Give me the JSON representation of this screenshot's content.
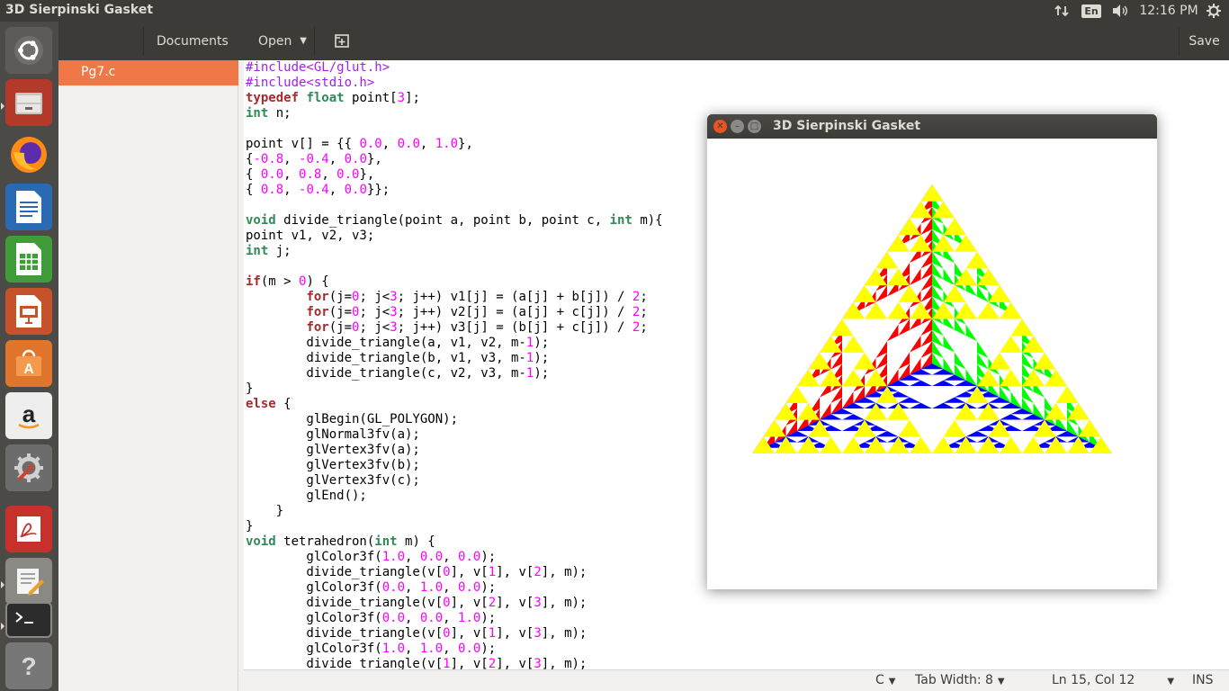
{
  "window_title": "3D Sierpinski Gasket",
  "top_panel": {
    "language": "En",
    "clock": "12:16 PM",
    "icons": [
      "network-icon",
      "volume-icon",
      "settings-gear-icon"
    ]
  },
  "launcher": {
    "items": [
      {
        "name": "ubuntu-dash",
        "active": false
      },
      {
        "name": "files",
        "active": true
      },
      {
        "name": "firefox",
        "active": false
      },
      {
        "name": "libreoffice-writer",
        "active": false
      },
      {
        "name": "libreoffice-calc",
        "active": false
      },
      {
        "name": "libreoffice-impress",
        "active": false
      },
      {
        "name": "ubuntu-software",
        "active": false
      },
      {
        "name": "amazon",
        "active": false
      },
      {
        "name": "system-settings",
        "active": false
      },
      {
        "name": "document-viewer",
        "active": false
      },
      {
        "name": "text-editor",
        "active": true
      },
      {
        "name": "terminal",
        "active": true
      },
      {
        "name": "help",
        "active": false
      }
    ]
  },
  "gedit": {
    "documents_label": "Documents",
    "open_label": "Open",
    "save_label": "Save",
    "files": [
      {
        "name": "Pg7.c",
        "selected": true
      }
    ],
    "status": {
      "language": "C",
      "tab_width": "Tab Width: 8",
      "position": "Ln 15, Col 12",
      "mode": "INS"
    },
    "code_lines": [
      [
        [
          "pp",
          "#include<GL/glut.h>"
        ]
      ],
      [
        [
          "pp",
          "#include<stdio.h>"
        ]
      ],
      [
        [
          "kw",
          "typedef"
        ],
        [
          "",
          " "
        ],
        [
          "ty",
          "float"
        ],
        [
          "",
          " point["
        ],
        [
          "num",
          "3"
        ],
        [
          "",
          "];"
        ]
      ],
      [
        [
          "ty",
          "int"
        ],
        [
          "",
          " n;"
        ]
      ],
      [],
      [
        [
          "",
          "point v[] = {{ "
        ],
        [
          "num",
          "0.0"
        ],
        [
          "",
          ", "
        ],
        [
          "num",
          "0.0"
        ],
        [
          "",
          ", "
        ],
        [
          "num",
          "1.0"
        ],
        [
          "",
          "},"
        ]
      ],
      [
        [
          "",
          "{"
        ],
        [
          "num",
          "-0.8"
        ],
        [
          "",
          ", "
        ],
        [
          "num",
          "-0.4"
        ],
        [
          "",
          ", "
        ],
        [
          "num",
          "0.0"
        ],
        [
          "",
          "},"
        ]
      ],
      [
        [
          "",
          "{ "
        ],
        [
          "num",
          "0.0"
        ],
        [
          "",
          ", "
        ],
        [
          "num",
          "0.8"
        ],
        [
          "",
          ", "
        ],
        [
          "num",
          "0.0"
        ],
        [
          "",
          "},"
        ]
      ],
      [
        [
          "",
          "{ "
        ],
        [
          "num",
          "0.8"
        ],
        [
          "",
          ", "
        ],
        [
          "num",
          "-0.4"
        ],
        [
          "",
          ", "
        ],
        [
          "num",
          "0.0"
        ],
        [
          "",
          "}};"
        ]
      ],
      [],
      [
        [
          "ty",
          "void"
        ],
        [
          "",
          " divide_triangle(point a, point b, point c, "
        ],
        [
          "ty",
          "int"
        ],
        [
          "",
          " m){"
        ]
      ],
      [
        [
          "",
          "point v1, v2, v3;"
        ]
      ],
      [
        [
          "ty",
          "int"
        ],
        [
          "",
          " j;"
        ]
      ],
      [],
      [
        [
          "kw",
          "if"
        ],
        [
          "",
          "(m > "
        ],
        [
          "num",
          "0"
        ],
        [
          "",
          ") {"
        ]
      ],
      [
        [
          "",
          "        "
        ],
        [
          "kw",
          "for"
        ],
        [
          "",
          "(j="
        ],
        [
          "num",
          "0"
        ],
        [
          "",
          "; j<"
        ],
        [
          "num",
          "3"
        ],
        [
          "",
          "; j++) v1[j] = (a[j] + b[j]) / "
        ],
        [
          "num",
          "2"
        ],
        [
          "",
          ";"
        ]
      ],
      [
        [
          "",
          "        "
        ],
        [
          "kw",
          "for"
        ],
        [
          "",
          "(j="
        ],
        [
          "num",
          "0"
        ],
        [
          "",
          "; j<"
        ],
        [
          "num",
          "3"
        ],
        [
          "",
          "; j++) v2[j] = (a[j] + c[j]) / "
        ],
        [
          "num",
          "2"
        ],
        [
          "",
          ";"
        ]
      ],
      [
        [
          "",
          "        "
        ],
        [
          "kw",
          "for"
        ],
        [
          "",
          "(j="
        ],
        [
          "num",
          "0"
        ],
        [
          "",
          "; j<"
        ],
        [
          "num",
          "3"
        ],
        [
          "",
          "; j++) v3[j] = (b[j] + c[j]) / "
        ],
        [
          "num",
          "2"
        ],
        [
          "",
          ";"
        ]
      ],
      [
        [
          "",
          "        divide_triangle(a, v1, v2, m-"
        ],
        [
          "num",
          "1"
        ],
        [
          "",
          ");"
        ]
      ],
      [
        [
          "",
          "        divide_triangle(b, v1, v3, m-"
        ],
        [
          "num",
          "1"
        ],
        [
          "",
          ");"
        ]
      ],
      [
        [
          "",
          "        divide_triangle(c, v2, v3, m-"
        ],
        [
          "num",
          "1"
        ],
        [
          "",
          ");"
        ]
      ],
      [
        [
          "",
          "}"
        ]
      ],
      [
        [
          "kw",
          "else"
        ],
        [
          "",
          " {"
        ]
      ],
      [
        [
          "",
          "        glBegin(GL_POLYGON);"
        ]
      ],
      [
        [
          "",
          "        glNormal3fv(a);"
        ]
      ],
      [
        [
          "",
          "        glVertex3fv(a);"
        ]
      ],
      [
        [
          "",
          "        glVertex3fv(b);"
        ]
      ],
      [
        [
          "",
          "        glVertex3fv(c);"
        ]
      ],
      [
        [
          "",
          "        glEnd();"
        ]
      ],
      [
        [
          "",
          "    }"
        ]
      ],
      [
        [
          "",
          "}"
        ]
      ],
      [
        [
          "ty",
          "void"
        ],
        [
          "",
          " tetrahedron("
        ],
        [
          "ty",
          "int"
        ],
        [
          "",
          " m) {"
        ]
      ],
      [
        [
          "",
          "        glColor3f("
        ],
        [
          "num",
          "1.0"
        ],
        [
          "",
          ", "
        ],
        [
          "num",
          "0.0"
        ],
        [
          "",
          ", "
        ],
        [
          "num",
          "0.0"
        ],
        [
          "",
          ");"
        ]
      ],
      [
        [
          "",
          "        divide_triangle(v["
        ],
        [
          "num",
          "0"
        ],
        [
          "",
          "], v["
        ],
        [
          "num",
          "1"
        ],
        [
          "",
          "], v["
        ],
        [
          "num",
          "2"
        ],
        [
          "",
          "], m);"
        ]
      ],
      [
        [
          "",
          "        glColor3f("
        ],
        [
          "num",
          "0.0"
        ],
        [
          "",
          ", "
        ],
        [
          "num",
          "1.0"
        ],
        [
          "",
          ", "
        ],
        [
          "num",
          "0.0"
        ],
        [
          "",
          ");"
        ]
      ],
      [
        [
          "",
          "        divide_triangle(v["
        ],
        [
          "num",
          "0"
        ],
        [
          "",
          "], v["
        ],
        [
          "num",
          "2"
        ],
        [
          "",
          "], v["
        ],
        [
          "num",
          "3"
        ],
        [
          "",
          "], m);"
        ]
      ],
      [
        [
          "",
          "        glColor3f("
        ],
        [
          "num",
          "0.0"
        ],
        [
          "",
          ", "
        ],
        [
          "num",
          "0.0"
        ],
        [
          "",
          ", "
        ],
        [
          "num",
          "1.0"
        ],
        [
          "",
          ");"
        ]
      ],
      [
        [
          "",
          "        divide_triangle(v["
        ],
        [
          "num",
          "0"
        ],
        [
          "",
          "], v["
        ],
        [
          "num",
          "1"
        ],
        [
          "",
          "], v["
        ],
        [
          "num",
          "3"
        ],
        [
          "",
          "], m);"
        ]
      ],
      [
        [
          "",
          "        glColor3f("
        ],
        [
          "num",
          "1.0"
        ],
        [
          "",
          ", "
        ],
        [
          "num",
          "1.0"
        ],
        [
          "",
          ", "
        ],
        [
          "num",
          "0.0"
        ],
        [
          "",
          ");"
        ]
      ],
      [
        [
          "",
          "        divide_triangle(v["
        ],
        [
          "num",
          "1"
        ],
        [
          "",
          "], v["
        ],
        [
          "num",
          "2"
        ],
        [
          "",
          "], v["
        ],
        [
          "num",
          "3"
        ],
        [
          "",
          "], m);"
        ]
      ]
    ]
  },
  "gl_window": {
    "title": "3D Sierpinski Gasket",
    "recursion_depth": 4,
    "colors": {
      "red": "#ff0000",
      "green": "#00ff00",
      "blue": "#0000ff",
      "yellow": "#ffff00",
      "background": "#ffffff"
    }
  },
  "theme": {
    "accent": "#f07746",
    "panel": "#3c3b37",
    "launcher": "#4b4a46"
  }
}
